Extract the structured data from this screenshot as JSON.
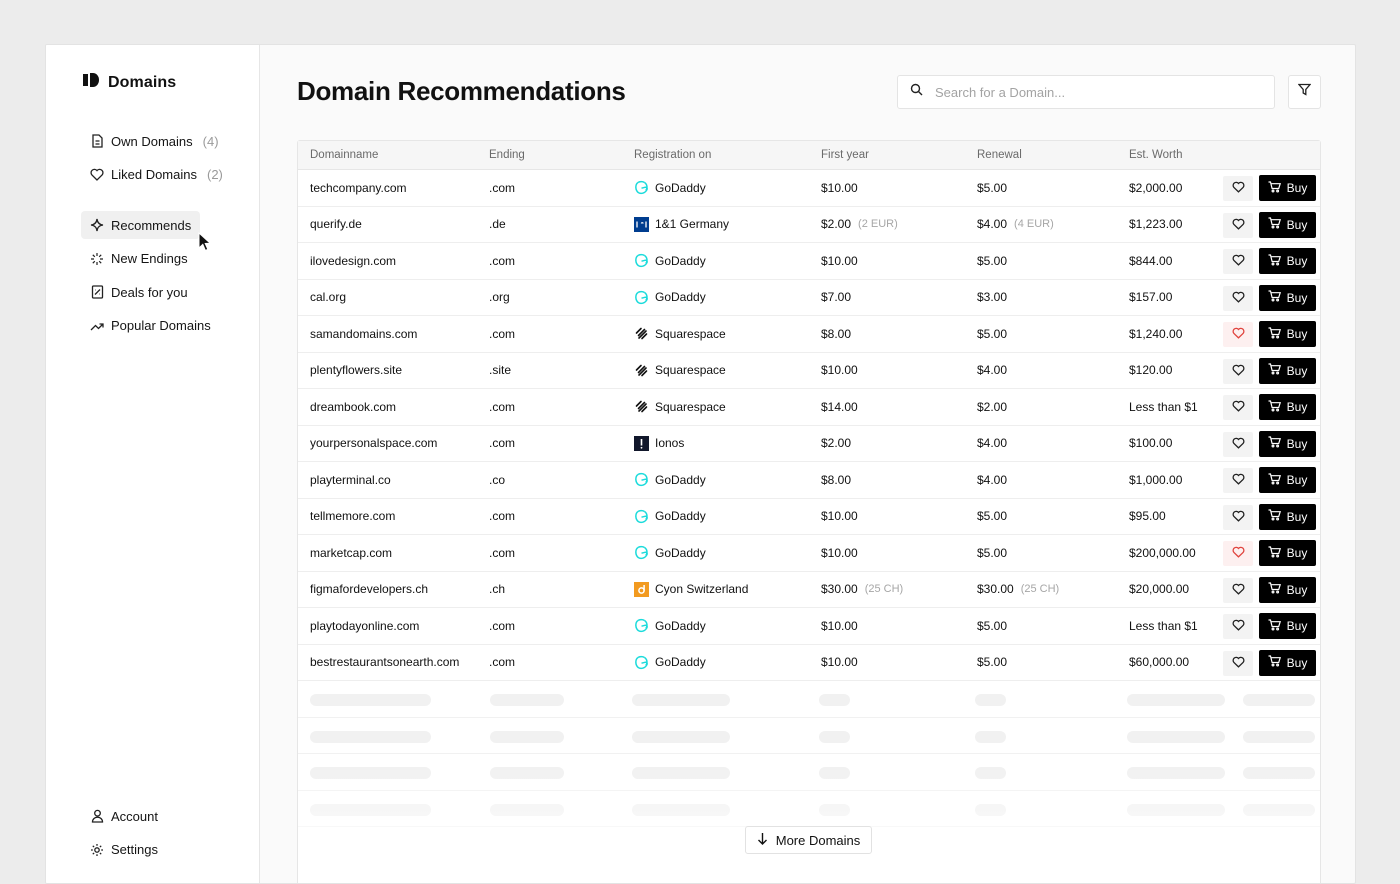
{
  "brand": {
    "name": "Domains"
  },
  "sidebar": {
    "top_items": [
      {
        "label": "Own Domains",
        "count": "(4)",
        "icon": "document-icon"
      },
      {
        "label": "Liked Domains",
        "count": "(2)",
        "icon": "heart-icon"
      }
    ],
    "mid_items": [
      {
        "label": "Recommends",
        "icon": "sparkle-icon",
        "active": true
      },
      {
        "label": "New Endings",
        "icon": "burst-icon"
      },
      {
        "label": "Deals for you",
        "icon": "receipt-icon"
      },
      {
        "label": "Popular Domains",
        "icon": "trending-icon"
      }
    ],
    "bottom_items": [
      {
        "label": "Account",
        "icon": "user-icon"
      },
      {
        "label": "Settings",
        "icon": "gear-icon"
      }
    ]
  },
  "main": {
    "title": "Domain Recommendations",
    "search": {
      "placeholder": "Search for a Domain..."
    },
    "more_button": "More Domains"
  },
  "table": {
    "columns": [
      "Domainname",
      "Ending",
      "Registration on",
      "First year",
      "Renewal",
      "Est. Worth"
    ],
    "buy_label": "Buy",
    "rows": [
      {
        "domain": "techcompany.com",
        "ending": ".com",
        "registrar": "GoDaddy",
        "first_year": "$10.00",
        "first_note": "",
        "renewal": "$5.00",
        "renewal_note": "",
        "worth": "$2,000.00",
        "liked": false
      },
      {
        "domain": "querify.de",
        "ending": ".de",
        "registrar": "1&1 Germany",
        "first_year": "$2.00",
        "first_note": "(2 EUR)",
        "renewal": "$4.00",
        "renewal_note": "(4 EUR)",
        "worth": "$1,223.00",
        "liked": false
      },
      {
        "domain": "ilovedesign.com",
        "ending": ".com",
        "registrar": "GoDaddy",
        "first_year": "$10.00",
        "first_note": "",
        "renewal": "$5.00",
        "renewal_note": "",
        "worth": "$844.00",
        "liked": false
      },
      {
        "domain": "cal.org",
        "ending": ".org",
        "registrar": "GoDaddy",
        "first_year": "$7.00",
        "first_note": "",
        "renewal": "$3.00",
        "renewal_note": "",
        "worth": "$157.00",
        "liked": false
      },
      {
        "domain": "samandomains.com",
        "ending": ".com",
        "registrar": "Squarespace",
        "first_year": "$8.00",
        "first_note": "",
        "renewal": "$5.00",
        "renewal_note": "",
        "worth": "$1,240.00",
        "liked": true
      },
      {
        "domain": "plentyflowers.site",
        "ending": ".site",
        "registrar": "Squarespace",
        "first_year": "$10.00",
        "first_note": "",
        "renewal": "$4.00",
        "renewal_note": "",
        "worth": "$120.00",
        "liked": false
      },
      {
        "domain": "dreambook.com",
        "ending": ".com",
        "registrar": "Squarespace",
        "first_year": "$14.00",
        "first_note": "",
        "renewal": "$2.00",
        "renewal_note": "",
        "worth": "Less than $1",
        "liked": false
      },
      {
        "domain": "yourpersonalspace.com",
        "ending": ".com",
        "registrar": "Ionos",
        "first_year": "$2.00",
        "first_note": "",
        "renewal": "$4.00",
        "renewal_note": "",
        "worth": "$100.00",
        "liked": false
      },
      {
        "domain": "playterminal.co",
        "ending": ".co",
        "registrar": "GoDaddy",
        "first_year": "$8.00",
        "first_note": "",
        "renewal": "$4.00",
        "renewal_note": "",
        "worth": "$1,000.00",
        "liked": false
      },
      {
        "domain": "tellmemore.com",
        "ending": ".com",
        "registrar": "GoDaddy",
        "first_year": "$10.00",
        "first_note": "",
        "renewal": "$5.00",
        "renewal_note": "",
        "worth": "$95.00",
        "liked": false
      },
      {
        "domain": "marketcap.com",
        "ending": ".com",
        "registrar": "GoDaddy",
        "first_year": "$10.00",
        "first_note": "",
        "renewal": "$5.00",
        "renewal_note": "",
        "worth": "$200,000.00",
        "liked": true
      },
      {
        "domain": "figmafordevelopers.ch",
        "ending": ".ch",
        "registrar": "Cyon Switzerland",
        "first_year": "$30.00",
        "first_note": "(25 CH)",
        "renewal": "$30.00",
        "renewal_note": "(25 CH)",
        "worth": "$20,000.00",
        "liked": false
      },
      {
        "domain": "playtodayonline.com",
        "ending": ".com",
        "registrar": "GoDaddy",
        "first_year": "$10.00",
        "first_note": "",
        "renewal": "$5.00",
        "renewal_note": "",
        "worth": "Less than $1",
        "liked": false
      },
      {
        "domain": "bestrestaurantsonearth.com",
        "ending": ".com",
        "registrar": "GoDaddy",
        "first_year": "$10.00",
        "first_note": "",
        "renewal": "$5.00",
        "renewal_note": "",
        "worth": "$60,000.00",
        "liked": false
      }
    ]
  },
  "colors": {
    "godaddy": "#1bdbdb",
    "oneandone": "#003d8f",
    "ionos": "#11172b",
    "cyon": "#f29a1f",
    "liked_heart": "#e0443e",
    "buy_bg": "#000000"
  }
}
